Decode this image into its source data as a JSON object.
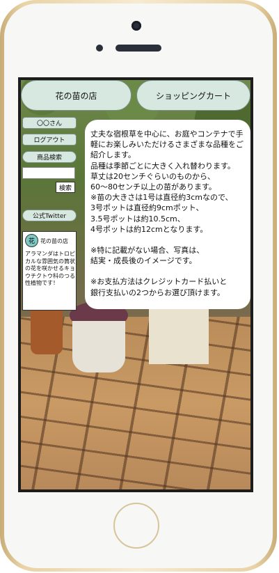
{
  "header": {
    "home_tab": "花の苗の店",
    "cart_tab": "ショッピングカート"
  },
  "sidebar": {
    "user": "〇〇さん",
    "logout": "ログアウト",
    "product_search": "商品検索",
    "search_placeholder": "",
    "search_button": "検索",
    "twitter": "公式Twitter"
  },
  "shop_card": {
    "logo_char": "花",
    "name": "花の苗の店",
    "description": "アラマンダはトロピカルな雰囲気の筒状の花を咲かせるキョウチクトウ科のつる性植物です！"
  },
  "info": {
    "para1": "丈夫な宿根草を中心に、お庭やコンテナで手軽にお楽しみいただけるさまざまな品種をご紹介します。\n品種は季節ごとに大きく入れ替わります。\n草丈は20センチぐらいのものから、\n60〜80センチ以上の苗があります。\n※苗の大きさは1号は直径約3cmなので、\n3号ポットは直径約9cmポット、\n3.5号ポットは約10.5cm、\n4号ポットは約12cmとなります。",
    "para2": "※特に記載がない場合、写真は、\n結実・成長後のイメージです。",
    "para3": "※お支払方法はクレジットカード払いと\n銀行支払いの2つからお選び頂けます。"
  }
}
